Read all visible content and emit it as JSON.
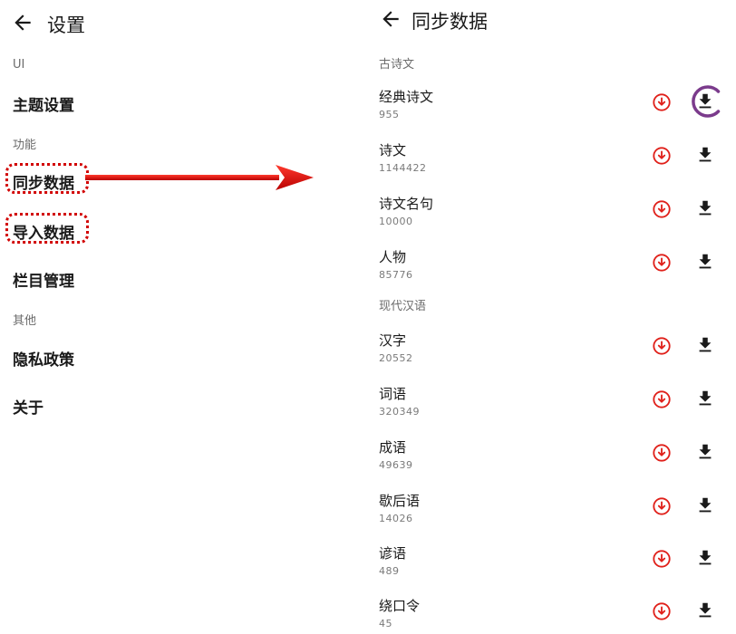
{
  "settings": {
    "title": "设置",
    "sections": [
      {
        "header": "UI",
        "items": [
          "主题设置"
        ]
      },
      {
        "header": "功能",
        "items": [
          "同步数据",
          "导入数据",
          "栏目管理"
        ]
      },
      {
        "header": "其他",
        "items": [
          "隐私政策",
          "关于"
        ]
      }
    ]
  },
  "sync": {
    "title": "同步数据",
    "categories": [
      {
        "header": "古诗文",
        "datasets": [
          {
            "name": "经典诗文",
            "count": "955"
          },
          {
            "name": "诗文",
            "count": "1144422"
          },
          {
            "name": "诗文名句",
            "count": "10000"
          },
          {
            "name": "人物",
            "count": "85776"
          }
        ]
      },
      {
        "header": "现代汉语",
        "datasets": [
          {
            "name": "汉字",
            "count": "20552"
          },
          {
            "name": "词语",
            "count": "320349"
          },
          {
            "name": "成语",
            "count": "49639"
          },
          {
            "name": "歇后语",
            "count": "14026"
          },
          {
            "name": "谚语",
            "count": "489"
          },
          {
            "name": "绕口令",
            "count": "45"
          }
        ]
      }
    ]
  },
  "colors": {
    "accent_red": "#e0201a",
    "highlight_red": "#d10000",
    "spinner_purple": "#7b3b8c"
  },
  "icons": {
    "back": "arrow-left-icon",
    "sync": "circle-arrow-down-icon",
    "download": "download-icon"
  }
}
